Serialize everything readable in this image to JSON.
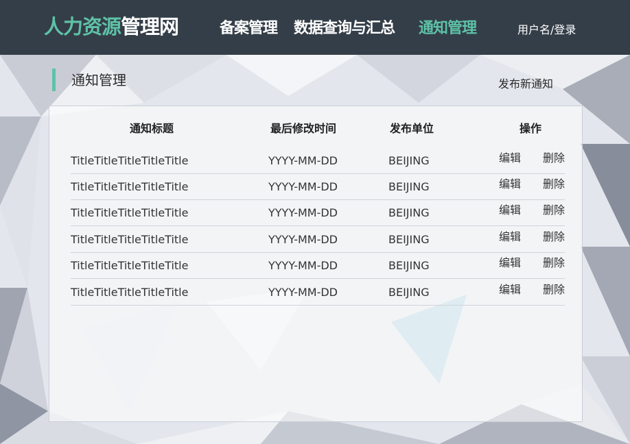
{
  "header": {
    "brand_accent": "人力资源",
    "brand_white": "管理网",
    "nav": [
      {
        "label": "备案管理",
        "active": false
      },
      {
        "label": "数据查询与汇总",
        "active": false
      },
      {
        "label": "通知管理",
        "active": true
      }
    ],
    "user_link": "用户名/登录"
  },
  "section": {
    "title": "通知管理",
    "publish_label": "发布新通知"
  },
  "table": {
    "columns": [
      "通知标题",
      "最后修改时间",
      "发布单位",
      "操作"
    ],
    "rows": [
      {
        "title": "TitleTitleTitleTitleTitle",
        "date": "YYYY-MM-DD",
        "unit": "BEIJING",
        "edit": "编辑",
        "delete": "删除"
      },
      {
        "title": "TitleTitleTitleTitleTitle",
        "date": "YYYY-MM-DD",
        "unit": "BEIJING",
        "edit": "编辑",
        "delete": "删除"
      },
      {
        "title": "TitleTitleTitleTitleTitle",
        "date": "YYYY-MM-DD",
        "unit": "BEIJING",
        "edit": "编辑",
        "delete": "删除"
      },
      {
        "title": "TitleTitleTitleTitleTitle",
        "date": "YYYY-MM-DD",
        "unit": "BEIJING",
        "edit": "编辑",
        "delete": "删除"
      },
      {
        "title": "TitleTitleTitleTitleTitle",
        "date": "YYYY-MM-DD",
        "unit": "BEIJING",
        "edit": "编辑",
        "delete": "删除"
      },
      {
        "title": "TitleTitleTitleTitleTitle",
        "date": "YYYY-MM-DD",
        "unit": "BEIJING",
        "edit": "编辑",
        "delete": "删除"
      }
    ]
  },
  "colors": {
    "accent": "#5ec2a7",
    "header_bg": "#343e48"
  }
}
